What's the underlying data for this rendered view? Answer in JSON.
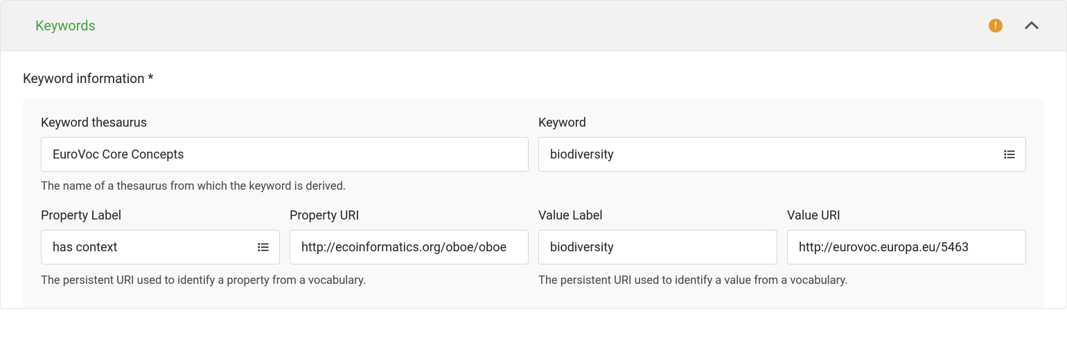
{
  "panel": {
    "title": "Keywords",
    "warning": "!"
  },
  "section": {
    "title": "Keyword information *"
  },
  "fields": {
    "thesaurus": {
      "label": "Keyword thesaurus",
      "value": "EuroVoc Core Concepts",
      "helper": "The name of a thesaurus from which the keyword is derived."
    },
    "keyword": {
      "label": "Keyword",
      "value": "biodiversity"
    },
    "propertyLabel": {
      "label": "Property Label",
      "value": "has context"
    },
    "propertyUri": {
      "label": "Property URI",
      "value": "http://ecoinformatics.org/oboe/oboe"
    },
    "valueLabel": {
      "label": "Value Label",
      "value": "biodiversity"
    },
    "valueUri": {
      "label": "Value URI",
      "value": "http://eurovoc.europa.eu/5463"
    },
    "propertyUriHelper": "The persistent URI used to identify a property from a vocabulary.",
    "valueUriHelper": "The persistent URI used to identify a value from a vocabulary."
  }
}
